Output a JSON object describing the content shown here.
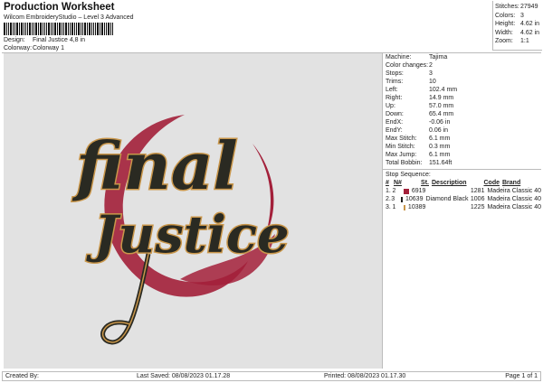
{
  "header": {
    "title": "Production Worksheet",
    "subtitle": "Wilcom EmbroideryStudio – Level 3 Advanced",
    "design_label": "Design:",
    "design_value": "Final Justice 4,8 in",
    "colorway_label": "Colorway:",
    "colorway_value": "Colorway 1"
  },
  "stats": [
    {
      "label": "Stitches:",
      "value": "27949"
    },
    {
      "label": "Colors:",
      "value": "3"
    },
    {
      "label": "Height:",
      "value": "4.62 in"
    },
    {
      "label": "Width:",
      "value": "4.62 in"
    },
    {
      "label": "Zoom:",
      "value": "1:1"
    }
  ],
  "details": [
    {
      "label": "Machine:",
      "value": "Tajima"
    },
    {
      "label": "Color changes:",
      "value": "2"
    },
    {
      "label": "Stops:",
      "value": "3"
    },
    {
      "label": "Trims:",
      "value": "10"
    },
    {
      "label": "Left:",
      "value": "102.4 mm"
    },
    {
      "label": "Right:",
      "value": "14.9 mm"
    },
    {
      "label": "Up:",
      "value": "57.0 mm"
    },
    {
      "label": "Down:",
      "value": "65.4 mm"
    },
    {
      "label": "EndX:",
      "value": "-0.06 in"
    },
    {
      "label": "EndY:",
      "value": "0.06 in"
    },
    {
      "label": "Max Stitch:",
      "value": "6.1 mm"
    },
    {
      "label": "Min Stitch:",
      "value": "0.3 mm"
    },
    {
      "label": "Max Jump:",
      "value": "6.1 mm"
    },
    {
      "label": "Total Bobbin:",
      "value": "151.64ft"
    }
  ],
  "stop_sequence": {
    "title": "Stop Sequence:",
    "columns": [
      "#",
      "N#",
      "St.",
      "Description",
      "Code",
      "Brand"
    ],
    "rows": [
      {
        "num": "1.",
        "n": "2",
        "color": "#a3203a",
        "st": "6919",
        "desc": "",
        "code": "1281",
        "brand": "Madeira Classic 40"
      },
      {
        "num": "2.",
        "n": "3",
        "color": "#222222",
        "st": "10639",
        "desc": "Diamond Black",
        "code": "1006",
        "brand": "Madeira Classic 40"
      },
      {
        "num": "3.",
        "n": "1",
        "color": "#c9964a",
        "st": "10389",
        "desc": "",
        "code": "1225",
        "brand": "Madeira Classic 40"
      }
    ]
  },
  "design": {
    "text_line1": "final",
    "text_line2": "Justice",
    "colors": {
      "red": "#a3203a",
      "black": "#2a2a22",
      "gold": "#c9964a"
    }
  },
  "footer": {
    "created_by": "Created By:",
    "last_saved": "Last Saved: 08/08/2023 01.17.28",
    "printed": "Printed: 08/08/2023 01.17.30",
    "page": "Page 1 of 1"
  }
}
